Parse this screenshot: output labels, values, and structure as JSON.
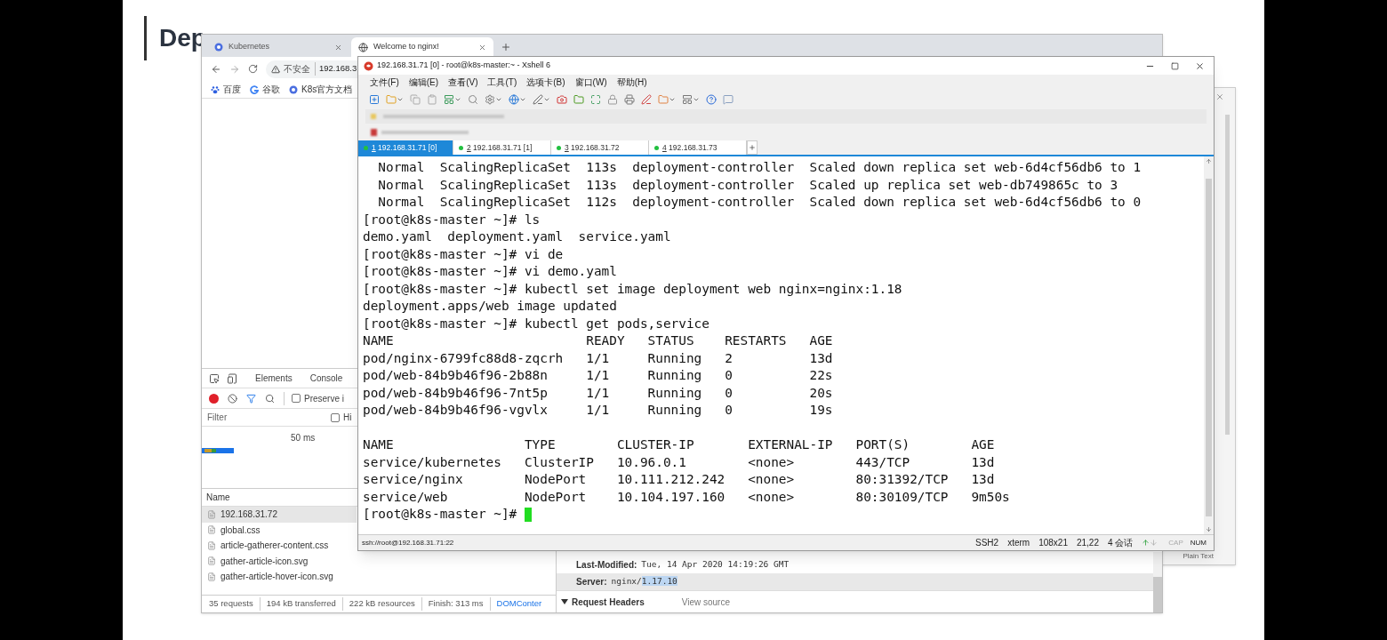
{
  "slide": {
    "title": "Dep"
  },
  "browser": {
    "tabs": [
      {
        "label": "Kubernetes",
        "kind": "k8s",
        "selected": false
      },
      {
        "label": "Welcome to nginx!",
        "kind": "globe",
        "selected": true
      }
    ],
    "address": {
      "security": "不安全",
      "url": "192.168.3"
    },
    "bookmarks": [
      {
        "label": "百度",
        "kind": "paw"
      },
      {
        "label": "谷歌",
        "kind": "ring"
      },
      {
        "label": "K8s官方文档",
        "kind": "k8s"
      }
    ],
    "devtools": {
      "tabs": [
        "Elements",
        "Console"
      ],
      "preserve_log": {
        "label": "Preserve i",
        "checked": false
      },
      "filter": {
        "placeholder": "Filter"
      },
      "hide_option": {
        "label": "Hi",
        "checked": false
      },
      "timeline_label": "50 ms",
      "name_header": "Name",
      "requests": [
        {
          "name": "192.168.31.72",
          "selected": true
        },
        {
          "name": "global.css",
          "selected": false
        },
        {
          "name": "article-gatherer-content.css",
          "selected": false
        },
        {
          "name": "gather-article-icon.svg",
          "selected": false
        },
        {
          "name": "gather-article-hover-icon.svg",
          "selected": false
        }
      ],
      "summary": [
        "35 requests",
        "194 kB transferred",
        "222 kB resources",
        "Finish: 313 ms"
      ],
      "summary_link": "DOMConter",
      "headers": [
        {
          "key": "Last-Modified:",
          "value": "Tue, 14 Apr 2020 14:19:26 GMT"
        },
        {
          "key": "Server:",
          "value": "nginx/",
          "selected_text": "1.17.10"
        }
      ],
      "section": {
        "title": "Request Headers",
        "expanded": true,
        "action": "View source"
      }
    }
  },
  "background_window": {
    "label": "Plain Text"
  },
  "xshell": {
    "title": "192.168.31.71 [0] - root@k8s-master:~ - Xshell 6",
    "menu": [
      "文件(F)",
      "编辑(E)",
      "查看(V)",
      "工具(T)",
      "选项卡(B)",
      "窗口(W)",
      "帮助(H)"
    ],
    "tabs": [
      {
        "number": "1",
        "label": "192.168.31.71 [0]",
        "selected": true
      },
      {
        "number": "2",
        "label": "192.168.31.71 [1]",
        "selected": false
      },
      {
        "number": "3",
        "label": "192.168.31.72",
        "selected": false
      },
      {
        "number": "4",
        "label": "192.168.31.73",
        "selected": false
      }
    ],
    "terminal": {
      "lines": [
        {
          "text": "  Normal  ScalingReplicaSet  113s  deployment-controller  Scaled down replica set web-6d4cf56db6 to 1"
        },
        {
          "text": "  Normal  ScalingReplicaSet  113s  deployment-controller  Scaled up replica set web-db749865c to 3"
        },
        {
          "text": "  Normal  ScalingReplicaSet  112s  deployment-controller  Scaled down replica set web-6d4cf56db6 to 0"
        },
        {
          "text": "[root@k8s-master ~]# ls"
        },
        {
          "text": "demo.yaml  deployment.yaml  service.yaml"
        },
        {
          "text": "[root@k8s-master ~]# vi de"
        },
        {
          "text": "[root@k8s-master ~]# vi demo.yaml"
        },
        {
          "text": "[root@k8s-master ~]# kubectl set image deployment web nginx=nginx:1.18"
        },
        {
          "text": "deployment.apps/web image updated"
        },
        {
          "text": "[root@k8s-master ~]# kubectl get pods,service"
        },
        {
          "text": "NAME                         READY   STATUS    RESTARTS   AGE"
        },
        {
          "text": "pod/nginx-6799fc88d8-zqcrh   1/1     Running   2          13d"
        },
        {
          "text": "pod/web-84b9b46f96-2b88n     1/1     Running   0          22s"
        },
        {
          "text": "pod/web-84b9b46f96-7nt5p     1/1     Running   0          20s"
        },
        {
          "text": "pod/web-84b9b46f96-vgvlx     1/1     Running   0          19s"
        },
        {
          "text": "NAME                 TYPE        CLUSTER-IP       EXTERNAL-IP   PORT(S)        AGE",
          "gap_before": true
        },
        {
          "text": "service/kubernetes   ClusterIP   10.96.0.1        <none>        443/TCP        13d"
        },
        {
          "text": "service/nginx        NodePort    10.111.212.242   <none>        80:31392/TCP   13d"
        },
        {
          "text": "service/web          NodePort    10.104.197.160   <none>        80:30109/TCP   9m50s"
        },
        {
          "text": "[root@k8s-master ~]# ",
          "cursor": true
        }
      ]
    },
    "status": {
      "connection": "ssh://root@192.168.31.71:22",
      "items": [
        "SSH2",
        "xterm",
        "108x21",
        "21,22",
        "4 会话"
      ],
      "indicators": [
        {
          "label": "CAP",
          "on": false
        },
        {
          "label": "NUM",
          "on": true
        }
      ]
    }
  }
}
